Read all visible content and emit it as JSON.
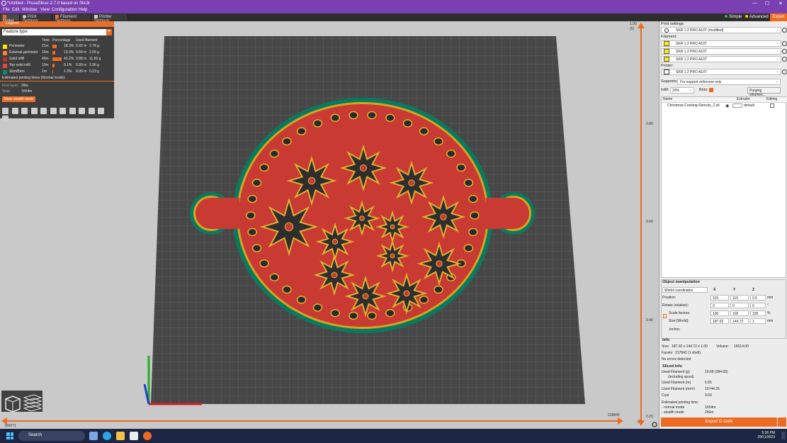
{
  "window": {
    "title": "*Untitled - PrusaSlicer-2.7.0 based on Slic3r",
    "controls": [
      "—",
      "☐",
      "✕"
    ]
  },
  "menu": [
    "File",
    "Edit",
    "Window",
    "View",
    "Configuration",
    "Help"
  ],
  "tabs": [
    {
      "label": "Plater",
      "active": true
    },
    {
      "label": "Print Settings",
      "active": false
    },
    {
      "label": "Filament Settings",
      "active": false
    },
    {
      "label": "Printer Settings",
      "active": false
    }
  ],
  "modes": {
    "simple": "Simple",
    "advanced": "Advanced",
    "expert": "Expert",
    "simple_color": "#33bb33",
    "advanced_color": "#ffcc00"
  },
  "legend": {
    "title": "Legend",
    "feature_type": "Feature type",
    "columns": {
      "time": "Time",
      "percentage": "Percentage",
      "used": "Used filament"
    },
    "rows": [
      {
        "name": "Perimeter",
        "time": "21m",
        "pct": "18.3%",
        "frac": 0.183,
        "m": "0.92 m",
        "g": "2.78 g",
        "color": "#ffe600"
      },
      {
        "name": "External perimeter",
        "time": "15m",
        "pct": "13.0%",
        "frac": 0.13,
        "m": "0.68 m",
        "g": "2.06 g",
        "color": "#ff7d38"
      },
      {
        "name": "Solid infill",
        "time": "49m",
        "pct": "43.2%",
        "frac": 0.432,
        "m": "3.88 m",
        "g": "11.65 g",
        "color": "#b03029"
      },
      {
        "name": "Top solid infill",
        "time": "10m",
        "pct": "9.1%",
        "frac": 0.091,
        "m": "0.99 m",
        "g": "2.96 g",
        "color": "#f04040"
      },
      {
        "name": "Skirt/Brim",
        "time": "1m",
        "pct": "1.3%",
        "frac": 0.013,
        "m": "0.08 m",
        "g": "0.23 g",
        "color": "#00876e"
      }
    ],
    "est_title": "Estimated printing times (Normal mode):",
    "first_layer_label": "First layer:",
    "first_layer": "28m",
    "total_label": "Total:",
    "total": "1h54m",
    "stealth_button": "Show stealth mode"
  },
  "hslider": {
    "left_top": "",
    "left_bottom": "186071",
    "right_top": "228840"
  },
  "vslider": {
    "top_value": "1.00",
    "top_layer": "(5)",
    "ticks": [
      "0.80",
      "0.60",
      "0.40"
    ],
    "bottom_value": "0.20",
    "bottom_layer": "(1)"
  },
  "sidebar": {
    "print_settings_label": "Print settings:",
    "print_settings_value": "SKR 1.2 PRO A10T (modified)",
    "filament_label": "Filament:",
    "filaments": [
      "SKR 1.2 PRO A10T",
      "SKR 1.2 PRO A10T",
      "SKR 1.2 PRO A10T"
    ],
    "filament_color": "#fff200",
    "printer_label": "Printer:",
    "printer_value": "SKR 1.2 PRO A10T",
    "supports_label": "Supports:",
    "supports_value": "For support enforcers only",
    "infill_label": "Infill:",
    "infill_value": "20%",
    "brim_label": "Brim:",
    "purging_button": "Purging volumes...",
    "table_headers": {
      "name": "Name",
      "extruder": "Extruder",
      "editing": "Editing"
    },
    "object_name": "Christmas-Cooking-Stencils_2.stl",
    "object_extruder": "default"
  },
  "object_manipulation": {
    "title": "Object manipulation",
    "coords": "World coordinates",
    "axes": [
      "X",
      "Y",
      "Z"
    ],
    "position_label": "Position:",
    "position": [
      "115",
      "115",
      "0.5"
    ],
    "position_unit": "mm",
    "rotate_label": "Rotate (relative):",
    "rotate": [
      "0",
      "0",
      "0"
    ],
    "rotate_unit": "°",
    "scale_label": "Scale factors:",
    "scale": [
      "100",
      "100",
      "100"
    ],
    "scale_unit": "%",
    "size_label": "Size [World]:",
    "size": [
      "187.02",
      "144.72",
      "1"
    ],
    "size_unit": "mm",
    "inches_label": "Inches"
  },
  "info": {
    "title": "Info",
    "size_label": "Size:",
    "size": "187.02 x 144.72 x 1.00",
    "volume_label": "Volume:",
    "volume": "15614.00",
    "facets_label": "Facets:",
    "facets": "217842 (1 shell)",
    "errors": "No errors detected"
  },
  "sliced_info": {
    "title": "Sliced Info",
    "rows": [
      {
        "label": "Used Filament (g)",
        "sub": "(including spool)",
        "value": "19.68 (284.68)"
      },
      {
        "label": "Used Filament (m)",
        "value": "6.55"
      },
      {
        "label": "Used Filament (mm³)",
        "value": "15744.35"
      },
      {
        "label": "Cost",
        "value": "0.69"
      }
    ],
    "est_label": "Estimated printing time:",
    "normal_label": "- normal mode",
    "normal": "1h54m",
    "stealth_label": "- stealth mode",
    "stealth": "2h0m"
  },
  "export_button": "Export G-code",
  "taskbar": {
    "search": "Search",
    "time": "5:26 PM",
    "date": "29/11/2023"
  }
}
